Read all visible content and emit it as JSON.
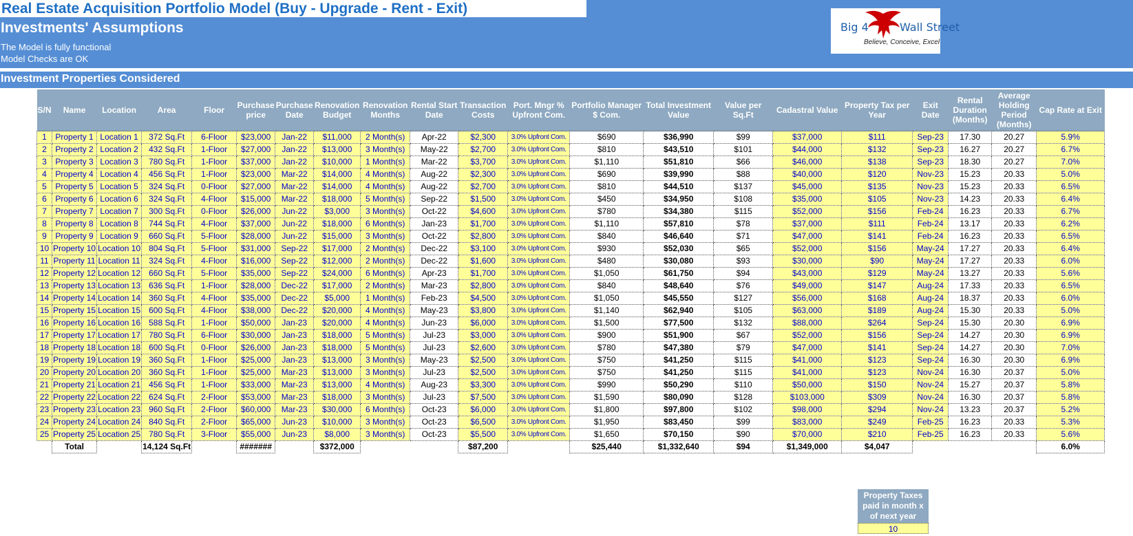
{
  "header": {
    "title": "Real Estate Acquisition Portfolio Model (Buy - Upgrade - Rent - Exit)",
    "subtitle": "Investments' Assumptions",
    "check_functional": "The Model is fully functional",
    "check_ok": "Model Checks are OK"
  },
  "logo": {
    "text_left": "Big 4",
    "text_right": "Wall Street",
    "tagline": "Believe, Conceive, Excel",
    "icon": "eagle-icon",
    "color": "#CC0000"
  },
  "section": {
    "title": "Investment Properties Considered"
  },
  "colors": {
    "band": "#558ED5",
    "header_cell": "#8EA9C1",
    "input_cell": "#FFFF99",
    "input_text": "#0000CC"
  },
  "table": {
    "columns": [
      "S/N",
      "Name",
      "Location",
      "Area",
      "Floor",
      "Purchase price",
      "Purchase Date",
      "Renovation Budget",
      "Renovation Months",
      "Rental Start Date",
      "Transaction Costs",
      "Port. Mngr % Upfront Com.",
      "Portfolio Manager $ Com.",
      "Total Investment Value",
      "Value per Sq.Ft",
      "Cadastral Value",
      "Property Tax per Year",
      "Exit Date",
      "Rental Duration (Months)",
      "Average Holding Period (Months)",
      "Cap Rate at Exit"
    ],
    "rows": [
      [
        "1",
        "Property 1",
        "Location 1",
        "372 Sq.Ft",
        "6-Floor",
        "$23,000",
        "Jan-22",
        "$11,000",
        "2 Month(s)",
        "Apr-22",
        "$2,300",
        "3.0% Upfront Com.",
        "$690",
        "$36,990",
        "$99",
        "$37,000",
        "$111",
        "Sep-23",
        "17.30",
        "20.27",
        "5.9%"
      ],
      [
        "2",
        "Property 2",
        "Location 2",
        "432 Sq.Ft",
        "1-Floor",
        "$27,000",
        "Jan-22",
        "$13,000",
        "3 Month(s)",
        "May-22",
        "$2,700",
        "3.0% Upfront Com.",
        "$810",
        "$43,510",
        "$101",
        "$44,000",
        "$132",
        "Sep-23",
        "16.27",
        "20.27",
        "6.7%"
      ],
      [
        "3",
        "Property 3",
        "Location 3",
        "780 Sq.Ft",
        "1-Floor",
        "$37,000",
        "Jan-22",
        "$10,000",
        "1 Month(s)",
        "Mar-22",
        "$3,700",
        "3.0% Upfront Com.",
        "$1,110",
        "$51,810",
        "$66",
        "$46,000",
        "$138",
        "Sep-23",
        "18.30",
        "20.27",
        "7.0%"
      ],
      [
        "4",
        "Property 4",
        "Location 4",
        "456 Sq.Ft",
        "1-Floor",
        "$23,000",
        "Mar-22",
        "$14,000",
        "4 Month(s)",
        "Aug-22",
        "$2,300",
        "3.0% Upfront Com.",
        "$690",
        "$39,990",
        "$88",
        "$40,000",
        "$120",
        "Nov-23",
        "15.23",
        "20.33",
        "5.0%"
      ],
      [
        "5",
        "Property 5",
        "Location 5",
        "324 Sq.Ft",
        "0-Floor",
        "$27,000",
        "Mar-22",
        "$14,000",
        "4 Month(s)",
        "Aug-22",
        "$2,700",
        "3.0% Upfront Com.",
        "$810",
        "$44,510",
        "$137",
        "$45,000",
        "$135",
        "Nov-23",
        "15.23",
        "20.33",
        "6.5%"
      ],
      [
        "6",
        "Property 6",
        "Location 6",
        "324 Sq.Ft",
        "4-Floor",
        "$15,000",
        "Mar-22",
        "$18,000",
        "5 Month(s)",
        "Sep-22",
        "$1,500",
        "3.0% Upfront Com.",
        "$450",
        "$34,950",
        "$108",
        "$35,000",
        "$105",
        "Nov-23",
        "14.23",
        "20.33",
        "6.4%"
      ],
      [
        "7",
        "Property 7",
        "Location 7",
        "300 Sq.Ft",
        "0-Floor",
        "$26,000",
        "Jun-22",
        "$3,000",
        "3 Month(s)",
        "Oct-22",
        "$4,600",
        "3.0% Upfront Com.",
        "$780",
        "$34,380",
        "$115",
        "$52,000",
        "$156",
        "Feb-24",
        "16.23",
        "20.33",
        "6.7%"
      ],
      [
        "8",
        "Property 8",
        "Location 8",
        "744 Sq.Ft",
        "4-Floor",
        "$37,000",
        "Jun-22",
        "$18,000",
        "6 Month(s)",
        "Jan-23",
        "$1,700",
        "3.0% Upfront Com.",
        "$1,110",
        "$57,810",
        "$78",
        "$37,000",
        "$111",
        "Feb-24",
        "13.17",
        "20.33",
        "6.2%"
      ],
      [
        "9",
        "Property 9",
        "Location 9",
        "660 Sq.Ft",
        "5-Floor",
        "$28,000",
        "Jun-22",
        "$15,000",
        "3 Month(s)",
        "Oct-22",
        "$2,800",
        "3.0% Upfront Com.",
        "$840",
        "$46,640",
        "$71",
        "$47,000",
        "$141",
        "Feb-24",
        "16.23",
        "20.33",
        "6.5%"
      ],
      [
        "10",
        "Property 10",
        "Location 10",
        "804 Sq.Ft",
        "5-Floor",
        "$31,000",
        "Sep-22",
        "$17,000",
        "2 Month(s)",
        "Dec-22",
        "$3,100",
        "3.0% Upfront Com.",
        "$930",
        "$52,030",
        "$65",
        "$52,000",
        "$156",
        "May-24",
        "17.27",
        "20.33",
        "6.4%"
      ],
      [
        "11",
        "Property 11",
        "Location 11",
        "324 Sq.Ft",
        "4-Floor",
        "$16,000",
        "Sep-22",
        "$12,000",
        "2 Month(s)",
        "Dec-22",
        "$1,600",
        "3.0% Upfront Com.",
        "$480",
        "$30,080",
        "$93",
        "$30,000",
        "$90",
        "May-24",
        "17.27",
        "20.33",
        "6.0%"
      ],
      [
        "12",
        "Property 12",
        "Location 12",
        "660 Sq.Ft",
        "5-Floor",
        "$35,000",
        "Sep-22",
        "$24,000",
        "6 Month(s)",
        "Apr-23",
        "$1,700",
        "3.0% Upfront Com.",
        "$1,050",
        "$61,750",
        "$94",
        "$43,000",
        "$129",
        "May-24",
        "13.27",
        "20.33",
        "5.6%"
      ],
      [
        "13",
        "Property 13",
        "Location 13",
        "636 Sq.Ft",
        "1-Floor",
        "$28,000",
        "Dec-22",
        "$17,000",
        "2 Month(s)",
        "Mar-23",
        "$2,800",
        "3.0% Upfront Com.",
        "$840",
        "$48,640",
        "$76",
        "$49,000",
        "$147",
        "Aug-24",
        "17.33",
        "20.33",
        "6.5%"
      ],
      [
        "14",
        "Property 14",
        "Location 14",
        "360 Sq.Ft",
        "4-Floor",
        "$35,000",
        "Dec-22",
        "$5,000",
        "1 Month(s)",
        "Feb-23",
        "$4,500",
        "3.0% Upfront Com.",
        "$1,050",
        "$45,550",
        "$127",
        "$56,000",
        "$168",
        "Aug-24",
        "18.37",
        "20.33",
        "6.0%"
      ],
      [
        "15",
        "Property 15",
        "Location 15",
        "600 Sq.Ft",
        "4-Floor",
        "$38,000",
        "Dec-22",
        "$20,000",
        "4 Month(s)",
        "May-23",
        "$3,800",
        "3.0% Upfront Com.",
        "$1,140",
        "$62,940",
        "$105",
        "$63,000",
        "$189",
        "Aug-24",
        "15.30",
        "20.33",
        "5.0%"
      ],
      [
        "16",
        "Property 16",
        "Location 16",
        "588 Sq.Ft",
        "1-Floor",
        "$50,000",
        "Jan-23",
        "$20,000",
        "4 Month(s)",
        "Jun-23",
        "$6,000",
        "3.0% Upfront Com.",
        "$1,500",
        "$77,500",
        "$132",
        "$88,000",
        "$264",
        "Sep-24",
        "15.30",
        "20.30",
        "6.9%"
      ],
      [
        "17",
        "Property 17",
        "Location 17",
        "780 Sq.Ft",
        "6-Floor",
        "$30,000",
        "Jan-23",
        "$18,000",
        "5 Month(s)",
        "Jul-23",
        "$3,000",
        "3.0% Upfront Com.",
        "$900",
        "$51,900",
        "$67",
        "$52,000",
        "$156",
        "Sep-24",
        "14.27",
        "20.30",
        "6.9%"
      ],
      [
        "18",
        "Property 18",
        "Location 18",
        "600 Sq.Ft",
        "0-Floor",
        "$26,000",
        "Jan-23",
        "$18,000",
        "5 Month(s)",
        "Jul-23",
        "$2,600",
        "3.0% Upfront Com.",
        "$780",
        "$47,380",
        "$79",
        "$47,000",
        "$141",
        "Sep-24",
        "14.27",
        "20.30",
        "7.0%"
      ],
      [
        "19",
        "Property 19",
        "Location 19",
        "360 Sq.Ft",
        "1-Floor",
        "$25,000",
        "Jan-23",
        "$13,000",
        "3 Month(s)",
        "May-23",
        "$2,500",
        "3.0% Upfront Com.",
        "$750",
        "$41,250",
        "$115",
        "$41,000",
        "$123",
        "Sep-24",
        "16.30",
        "20.30",
        "6.9%"
      ],
      [
        "20",
        "Property 20",
        "Location 20",
        "360 Sq.Ft",
        "1-Floor",
        "$25,000",
        "Mar-23",
        "$13,000",
        "3 Month(s)",
        "Jul-23",
        "$2,500",
        "3.0% Upfront Com.",
        "$750",
        "$41,250",
        "$115",
        "$41,000",
        "$123",
        "Nov-24",
        "16.30",
        "20.37",
        "5.0%"
      ],
      [
        "21",
        "Property 21",
        "Location 21",
        "456 Sq.Ft",
        "1-Floor",
        "$33,000",
        "Mar-23",
        "$13,000",
        "4 Month(s)",
        "Aug-23",
        "$3,300",
        "3.0% Upfront Com.",
        "$990",
        "$50,290",
        "$110",
        "$50,000",
        "$150",
        "Nov-24",
        "15.27",
        "20.37",
        "5.8%"
      ],
      [
        "22",
        "Property 22",
        "Location 22",
        "624 Sq.Ft",
        "2-Floor",
        "$53,000",
        "Mar-23",
        "$18,000",
        "3 Month(s)",
        "Jul-23",
        "$7,500",
        "3.0% Upfront Com.",
        "$1,590",
        "$80,090",
        "$128",
        "$103,000",
        "$309",
        "Nov-24",
        "16.30",
        "20.37",
        "5.8%"
      ],
      [
        "23",
        "Property 23",
        "Location 23",
        "960 Sq.Ft",
        "2-Floor",
        "$60,000",
        "Mar-23",
        "$30,000",
        "6 Month(s)",
        "Oct-23",
        "$6,000",
        "3.0% Upfront Com.",
        "$1,800",
        "$97,800",
        "$102",
        "$98,000",
        "$294",
        "Nov-24",
        "13.23",
        "20.37",
        "5.2%"
      ],
      [
        "24",
        "Property 24",
        "Location 24",
        "840 Sq.Ft",
        "2-Floor",
        "$65,000",
        "Jun-23",
        "$10,000",
        "3 Month(s)",
        "Oct-23",
        "$6,500",
        "3.0% Upfront Com.",
        "$1,950",
        "$83,450",
        "$99",
        "$83,000",
        "$249",
        "Feb-25",
        "16.23",
        "20.33",
        "5.3%"
      ],
      [
        "25",
        "Property 25",
        "Location 25",
        "780 Sq.Ft",
        "3-Floor",
        "$55,000",
        "Jun-23",
        "$8,000",
        "3 Month(s)",
        "Oct-23",
        "$5,500",
        "3.0% Upfront Com.",
        "$1,650",
        "$70,150",
        "$90",
        "$70,000",
        "$210",
        "Feb-25",
        "16.23",
        "20.33",
        "5.6%"
      ]
    ],
    "totals": {
      "label": "Total",
      "area": "14,124 Sq.Ft",
      "purchase_price": "#######",
      "renovation": "$372,000",
      "transaction": "$87,200",
      "pm_com": "$25,440",
      "total_investment": "$1,332,640",
      "value_per_sqft": "$94",
      "cadastral": "$1,349,000",
      "tax": "$4,047",
      "cap_rate": "6.0%"
    }
  },
  "tax_payment": {
    "label": "Property Taxes paid in month x of next year",
    "value": "10"
  }
}
